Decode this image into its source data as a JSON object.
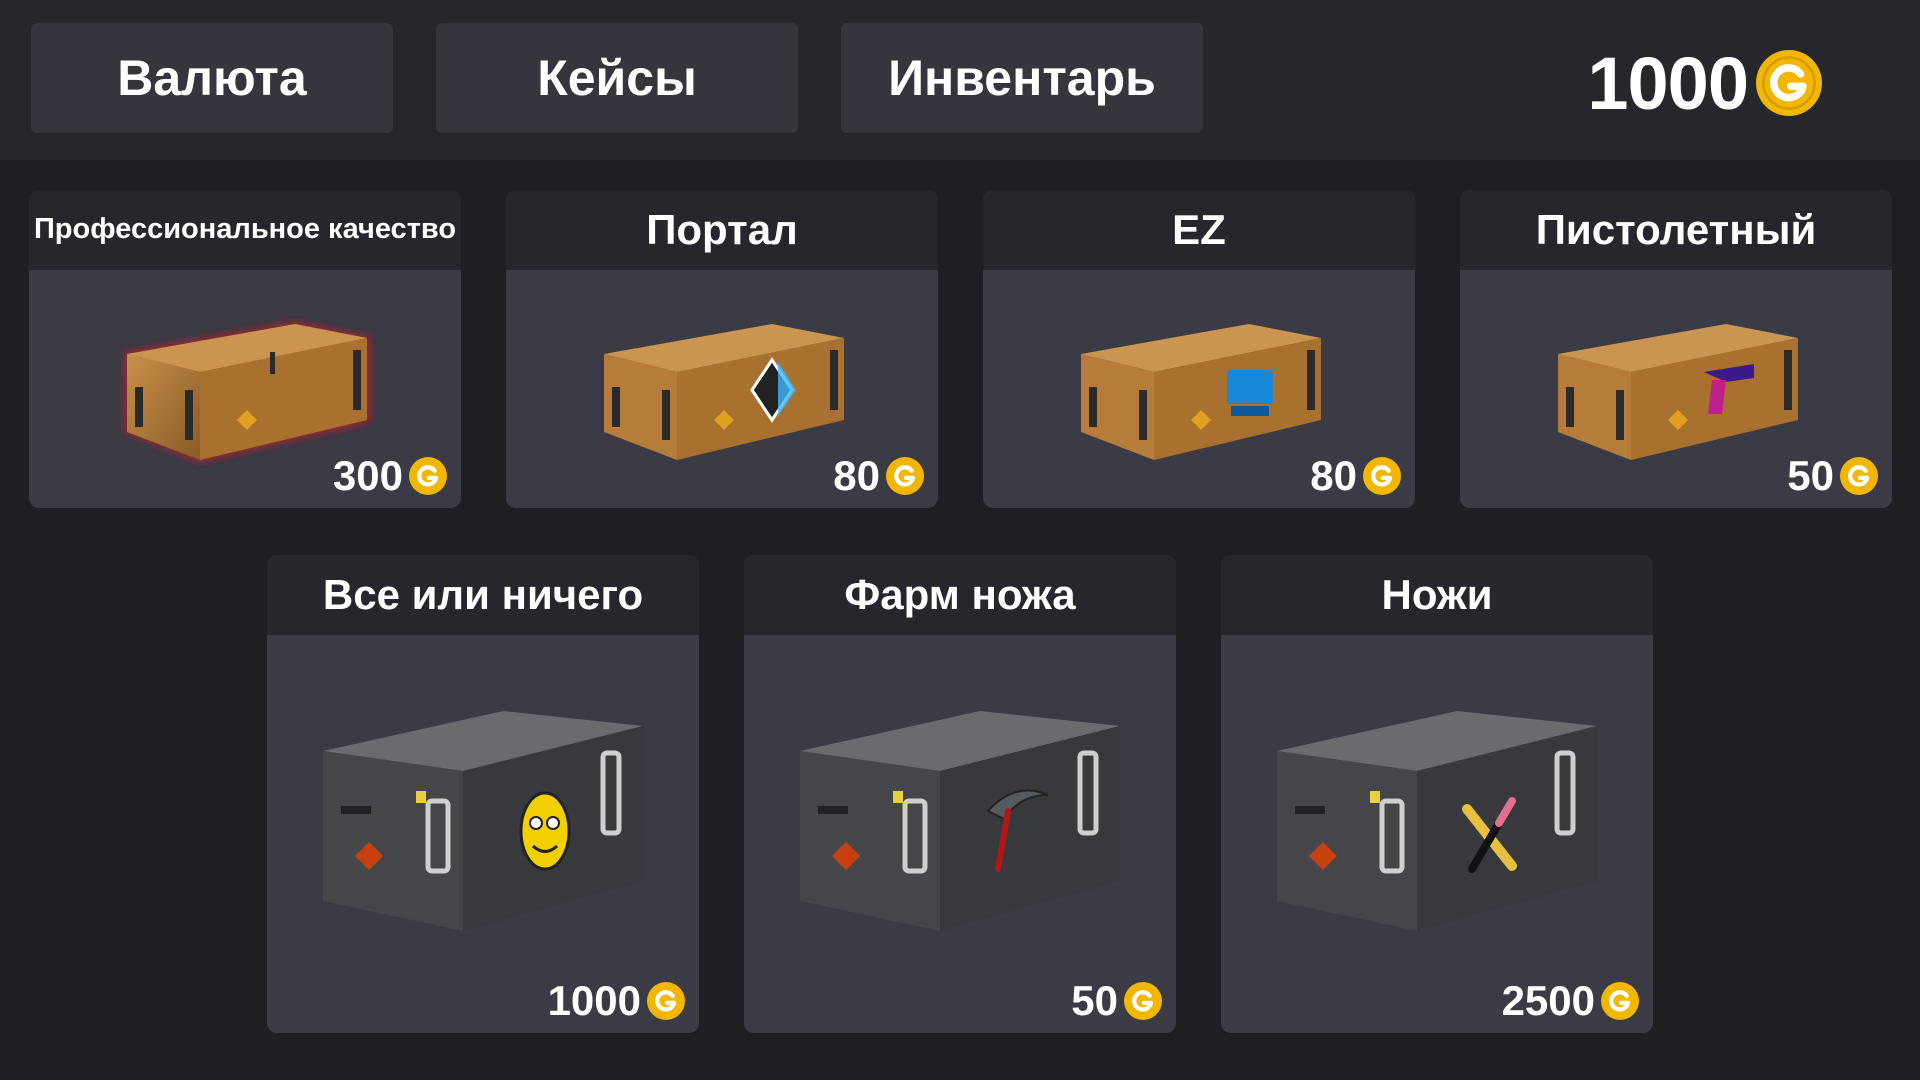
{
  "nav": {
    "currency_label": "Валюта",
    "cases_label": "Кейсы",
    "inventory_label": "Инвентарь"
  },
  "balance": {
    "amount": "1000",
    "coin_icon": "coin-icon"
  },
  "colors": {
    "background": "#1e1f24",
    "bar": "#26272d",
    "button": "#34353d",
    "card_body": "#3a3b45",
    "coin": "#f2b705"
  },
  "cases": [
    {
      "title": "Профессиональное качество",
      "price": "300",
      "style": "wooden",
      "highlight": "red-glow",
      "sticker": "hazard"
    },
    {
      "title": "Портал",
      "price": "80",
      "style": "wooden",
      "sticker": "portal-diamond"
    },
    {
      "title": "EZ",
      "price": "80",
      "style": "wooden",
      "sticker": "ez-logo"
    },
    {
      "title": "Пистолетный",
      "price": "50",
      "style": "wooden",
      "sticker": "pistol"
    },
    {
      "title": "Все или ничего",
      "price": "1000",
      "style": "metal",
      "sticker": "smiley-face"
    },
    {
      "title": "Фарм ножа",
      "price": "50",
      "style": "metal",
      "sticker": "pickaxe"
    },
    {
      "title": "Ножи",
      "price": "2500",
      "style": "metal",
      "sticker": "crossed-knives"
    }
  ]
}
